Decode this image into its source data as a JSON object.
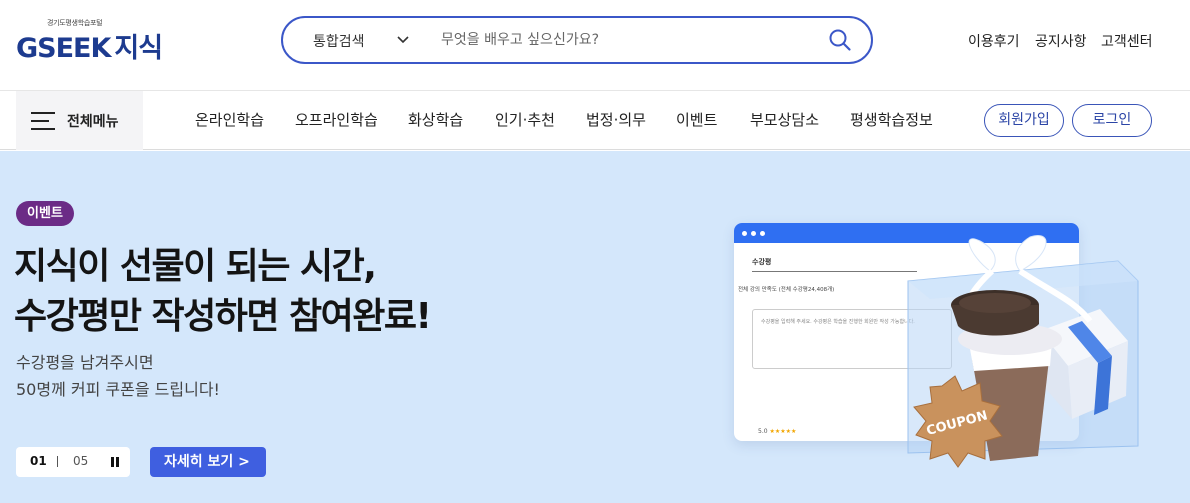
{
  "header": {
    "logo_small": "경기도평생학습포털",
    "logo_main": "GSEEK",
    "logo_kor": "지식",
    "search": {
      "type_label": "통합검색",
      "placeholder": "무엇을 배우고 싶으신가요?"
    },
    "util_links": [
      "이용후기",
      "공지사항",
      "고객센터"
    ]
  },
  "nav": {
    "all_menu_label": "전체메뉴",
    "items": [
      "온라인학습",
      "오프라인학습",
      "화상학습",
      "인기·추천",
      "법정·의무",
      "이벤트",
      "부모상담소",
      "평생학습정보"
    ],
    "signup_label": "회원가입",
    "login_label": "로그인"
  },
  "banner": {
    "badge": "이벤트",
    "headline_line1": "지식이 선물이 되는 시간,",
    "headline_line2": "수강평만 작성하면 참여완료!",
    "sub_line1": "수강평을 남겨주시면",
    "sub_line2": "50명께 커피 쿠폰을 드립니다!",
    "pager_current": "01",
    "pager_total": "05",
    "detail_button": "자세히 보기  >",
    "illustration": {
      "window_title": "수강평",
      "rating_summary": "전체 강의 만족도 (전체 수강평24,408개)",
      "placeholder": "수강평을 입력해 주세요. 수강평은 학습을 진행한 회원만 작성 가능합니다.",
      "score": "5.0",
      "stars": "★★★★★",
      "coupon_text": "COUPON"
    }
  },
  "colors": {
    "brand_blue": "#1d3b8f",
    "search_border": "#3b57c8",
    "banner_bg": "#d4e7fb",
    "badge_purple": "#6b2b86",
    "button_blue": "#3f5fe0"
  },
  "icons": {
    "search": "search-icon",
    "chevron": "chevron-down-icon",
    "menu": "hamburger-icon",
    "pause": "pause-icon"
  }
}
